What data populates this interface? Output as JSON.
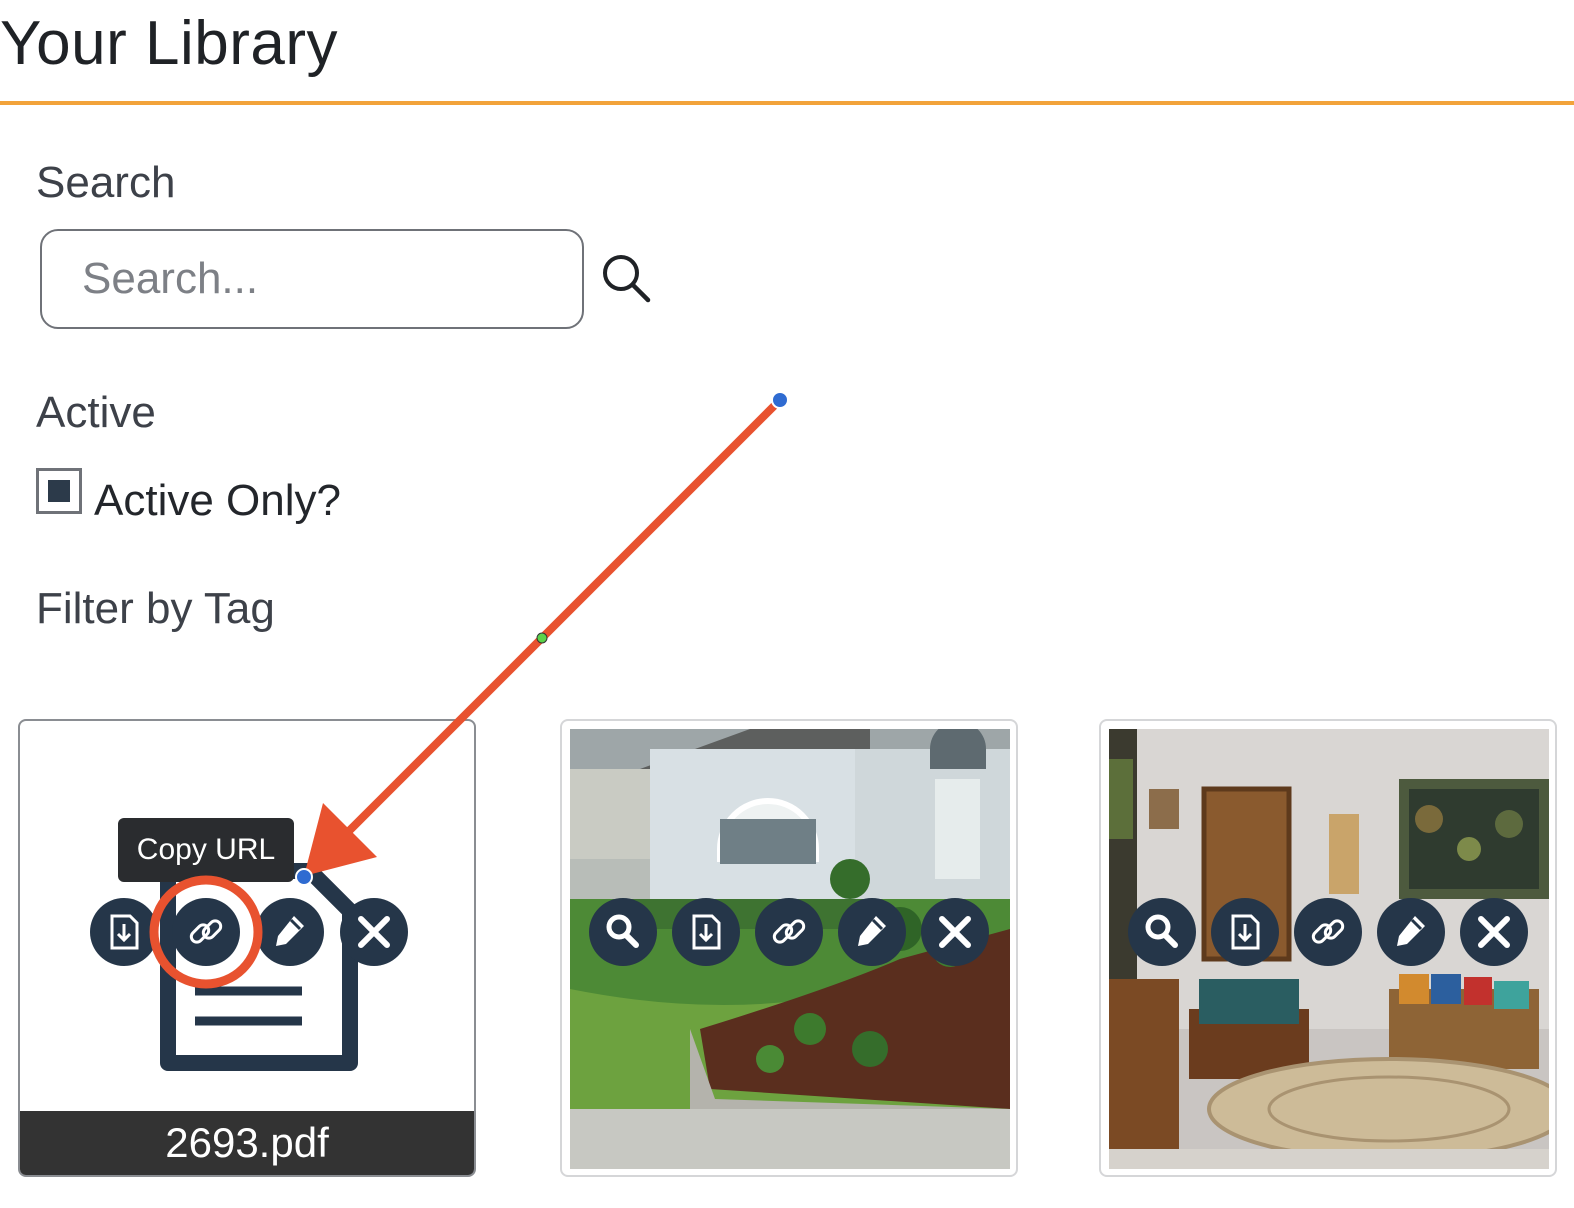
{
  "page": {
    "title": "Your Library"
  },
  "search": {
    "label": "Search",
    "placeholder": "Search..."
  },
  "active": {
    "label": "Active",
    "checkbox_label": "Active Only?",
    "checked": true
  },
  "filter": {
    "label": "Filter by Tag"
  },
  "tooltip": {
    "text": "Copy URL"
  },
  "library_items": [
    {
      "type": "pdf-document",
      "filename": "2693.pdf",
      "actions": [
        "download-icon",
        "link-icon",
        "pencil-icon",
        "close-icon"
      ]
    },
    {
      "type": "image",
      "description_icon": "house-exterior-photo",
      "actions": [
        "search-icon",
        "download-icon",
        "link-icon",
        "pencil-icon",
        "close-icon"
      ]
    },
    {
      "type": "image",
      "description_icon": "living-room-photo",
      "actions": [
        "search-icon",
        "download-icon",
        "link-icon",
        "pencil-icon",
        "close-icon"
      ]
    }
  ],
  "colors": {
    "accent_rule": "#f2a33a",
    "action_button": "#253649",
    "annotation_arrow": "#e8522f",
    "highlight_circle": "#e8522f"
  }
}
